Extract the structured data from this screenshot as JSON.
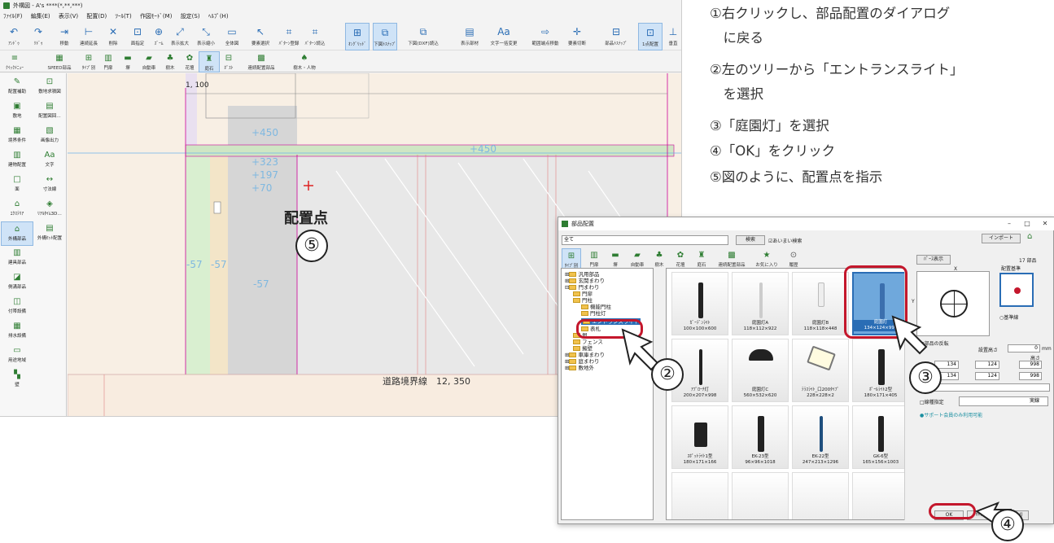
{
  "app": {
    "title": "外構図 - A's ****(*,**,***)",
    "menu": [
      "ﾌｧｲﾙ(F)",
      "編集(E)",
      "表示(V)",
      "配置(D)",
      "ﾂｰﾙ(T)",
      "作図ﾓｰﾄﾞ(M)",
      "設定(S)",
      "ﾍﾙﾌﾟ(H)"
    ],
    "toolbar1": [
      "ｱﾝﾄﾞｩ",
      "ﾘﾄﾞｩ",
      "移動",
      "連続延長",
      "削除",
      "面指定",
      "ｽﾞｰﾑ",
      "表示拡大",
      "表示縮小",
      "全体図",
      "要素選択",
      "ﾊﾟﾀｰﾝ登録",
      "ﾊﾟﾀｰﾝ読込",
      "ｵﾝｸﾞﾘｯﾄﾞ",
      "下図ﾄｽﾅｯﾌﾟ",
      "下図(DXF)読込",
      "表示部材",
      "文字一括変更",
      "範囲端点移動",
      "要素切断",
      "部品ﾄｽﾅｯﾌﾟ",
      "1点配置",
      "垂直"
    ],
    "toolbar2": [
      "ｸｲｯｸﾒﾆｭｰ",
      "SPEED部品",
      "ﾀｲﾌﾟ別",
      "門扉",
      "塀",
      "自動車",
      "樹木",
      "花壇",
      "庭石",
      "ﾎﾟｽﾄ",
      "連続配置部品",
      "樹木・人物"
    ],
    "left_panel": [
      "配置補助",
      "敷地求積図",
      "敷地",
      "配置図回…",
      "境界条件",
      "画像出力",
      "建物配置",
      "文字",
      "面",
      "寸法線",
      "ｴｸｽﾃﾘｱ",
      "ﾘｱﾙﾀｲﾑ3D…",
      "外構部品",
      "外構ｾｯﾄ配置",
      "建具部品",
      "側溝部品",
      "付帯設備",
      "排水設備",
      "用途地域",
      "壁"
    ],
    "canvas": {
      "dim_top": "1, 100",
      "labels": [
        "+450",
        "+323",
        "+197",
        "+70",
        "+450",
        "-57",
        "-57",
        "-57"
      ],
      "road_label": "道路境界線　12, 350",
      "point_label": "配置点",
      "step5": "⑤"
    }
  },
  "dialog": {
    "title": "部品配置",
    "category": "全て",
    "search_button": "検索",
    "fuzzy_label": "☑あいまい検索",
    "import_button": "インポート",
    "tabs": [
      "ﾀｲﾌﾟ別",
      "門扉",
      "塀",
      "自動車",
      "樹木",
      "花壇",
      "庭石",
      "連続配置部品",
      "お気に入り",
      "履歴"
    ],
    "tree": [
      "汎用部品",
      "玄関まわり",
      "門まわり",
      "門扉",
      "門柱",
      "機能門柱",
      "門柱灯",
      "エントランスライト",
      "表札",
      "塀",
      "フェンス",
      "擁壁",
      "車庫まわり",
      "庭まわり",
      "敷地外"
    ],
    "parts": [
      {
        "name": "ｶﾞｰﾃﾞﾝﾗｲﾄ",
        "size": "100×100×600"
      },
      {
        "name": "庭園灯A",
        "size": "118×112×922"
      },
      {
        "name": "庭園灯B",
        "size": "118×118×448"
      },
      {
        "name": "庭園灯",
        "size": "134×124×998"
      },
      {
        "name": "ｱﾌﾟﾛｰﾁ灯",
        "size": "200×207×998"
      },
      {
        "name": "庭園灯C",
        "size": "560×532×620"
      },
      {
        "name": "ﾃﾗｽﾗｲﾄ_口200ﾀｲﾌﾟ",
        "size": "228×228×2"
      },
      {
        "name": "ﾎﾟｰﾙﾗｲﾄ2型",
        "size": "180×171×405"
      },
      {
        "name": "ｽﾎﾟｯﾄﾗｲﾄ1型",
        "size": "180×171×166"
      },
      {
        "name": "EK-23型",
        "size": "96×96×1018"
      },
      {
        "name": "EK-22型",
        "size": "247×213×1296"
      },
      {
        "name": "GK-6型",
        "size": "165×156×1003"
      }
    ],
    "perse_button": "ﾊﾟｰｽ表示",
    "count": "17 部品",
    "x_label": "X",
    "y_label": "Y",
    "origin_label": "配置基準",
    "flip_label": "□部品の反転",
    "baseline_label": "○基準線",
    "height_label": "設置高さ",
    "height_value": "0",
    "unit": "mm",
    "x_value": "134",
    "y_value": "124",
    "z_value": "998",
    "high_label": "高さ",
    "memo_label": "ﾒﾓ",
    "line_type_label": "□線種指定",
    "line_type_value": "実線",
    "support_note": "●サポート会員のみ利用可能",
    "ok_button": "OK",
    "cancel_button": "ｷｬﾝｾﾙ",
    "help_button": "ﾍﾙﾌﾟ(H)"
  },
  "instructions": [
    "①右クリックし、部品配置のダイアログ",
    "　に戻る",
    "②左のツリーから「エントランスライト」",
    "　を選択",
    "③「庭園灯」を選択",
    "④「OK」をクリック",
    "⑤図のように、配置点を指示"
  ],
  "callouts": {
    "c2": "②",
    "c3": "③",
    "c4": "④"
  },
  "colors": {
    "accent_red": "#c4172c",
    "select_blue": "#2a6db5",
    "canvas_bg": "#f8efe4"
  }
}
